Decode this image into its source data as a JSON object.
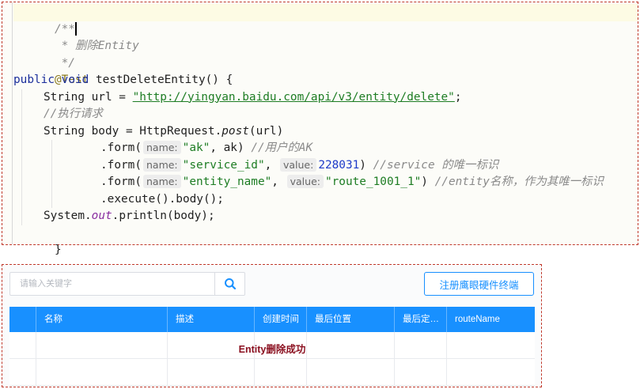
{
  "code": {
    "javadoc_open": "/**",
    "javadoc_desc": " * 删除Entity",
    "javadoc_close": " */",
    "annotation": "@Test",
    "method_kw1": "public",
    "method_kw2": "void",
    "method_sig": "testDeleteEntity() {",
    "url_decl": "String url = ",
    "url_value": "\"http://yingyan.baidu.com/api/v3/entity/delete\"",
    "comment_exec": "//执行请求",
    "body_decl": "String body = HttpRequest.",
    "body_call": "post",
    "body_arg": "(url)",
    "form_call": ".form(",
    "hint_name": "name:",
    "hint_value": "value:",
    "form1_key": "\"ak\"",
    "form1_val": "ak)",
    "form1_comment": "//用户的AK",
    "form2_key": "\"service_id\"",
    "form2_val": "228031",
    "form2_comment": "//service 的唯一标识",
    "form3_key": "\"entity_name\"",
    "form3_val": "\"route_1001_1\"",
    "form3_comment": "//entity名称，作为其唯一标识",
    "exec_line": ".execute().body();",
    "print_prefix": "System.",
    "print_field": "out",
    "print_suffix": ".println(body);",
    "close_brace": "}",
    "comma": ", ",
    "close_paren": ")"
  },
  "ui": {
    "search": {
      "placeholder": "请输入关键字",
      "icon": "search-icon"
    },
    "register_button": "注册鹰眼硬件终端",
    "table": {
      "headers": [
        "名称",
        "描述",
        "创建时间",
        "最后位置",
        "最后定位...",
        "routeName"
      ],
      "message": "Entity删除成功"
    },
    "colors": {
      "accent": "#1890ff",
      "message": "#8b1020",
      "border": "#c0392b"
    }
  }
}
